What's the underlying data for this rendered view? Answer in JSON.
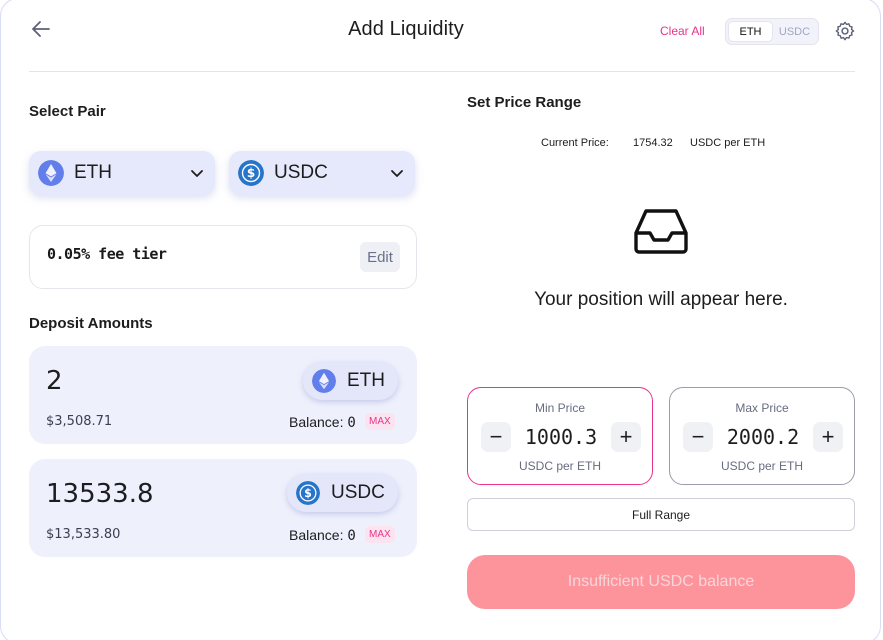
{
  "header": {
    "title": "Add Liquidity",
    "clear_all": "Clear All",
    "toggle": [
      "ETH",
      "USDC"
    ]
  },
  "pair": {
    "label": "Select Pair",
    "token_a": "ETH",
    "token_b": "USDC"
  },
  "fee": {
    "text": "0.05% fee tier",
    "edit_label": "Edit"
  },
  "deposit": {
    "label": "Deposit Amounts",
    "items": [
      {
        "amount": "2",
        "usd": "$3,508.71",
        "token": "ETH",
        "balance_label": "Balance:",
        "balance": "0",
        "max": "MAX"
      },
      {
        "amount": "13533.8",
        "usd": "$13,533.80",
        "token": "USDC",
        "balance_label": "Balance:",
        "balance": "0",
        "max": "MAX"
      }
    ]
  },
  "range": {
    "label": "Set Price Range",
    "current_price_label": "Current Price:",
    "current_price": "1754.32",
    "current_price_unit": "USDC per ETH",
    "empty_text": "Your position will appear here.",
    "min": {
      "label": "Min Price",
      "value": "1000.3",
      "unit": "USDC per ETH"
    },
    "max": {
      "label": "Max Price",
      "value": "2000.2",
      "unit": "USDC per ETH"
    },
    "full_range": "Full Range"
  },
  "submit_label": "Insufficient USDC balance",
  "icons": {
    "back": "arrow-left-icon",
    "settings": "gear-icon",
    "eth": "eth-icon",
    "usdc": "usdc-icon",
    "chevron": "chevron-down-icon",
    "inbox": "inbox-icon"
  },
  "colors": {
    "accent": "#e8348b",
    "eth": "#627eea",
    "usdc": "#2775ca",
    "submit_bg": "#fd949b",
    "min_border": "#e8348b"
  }
}
